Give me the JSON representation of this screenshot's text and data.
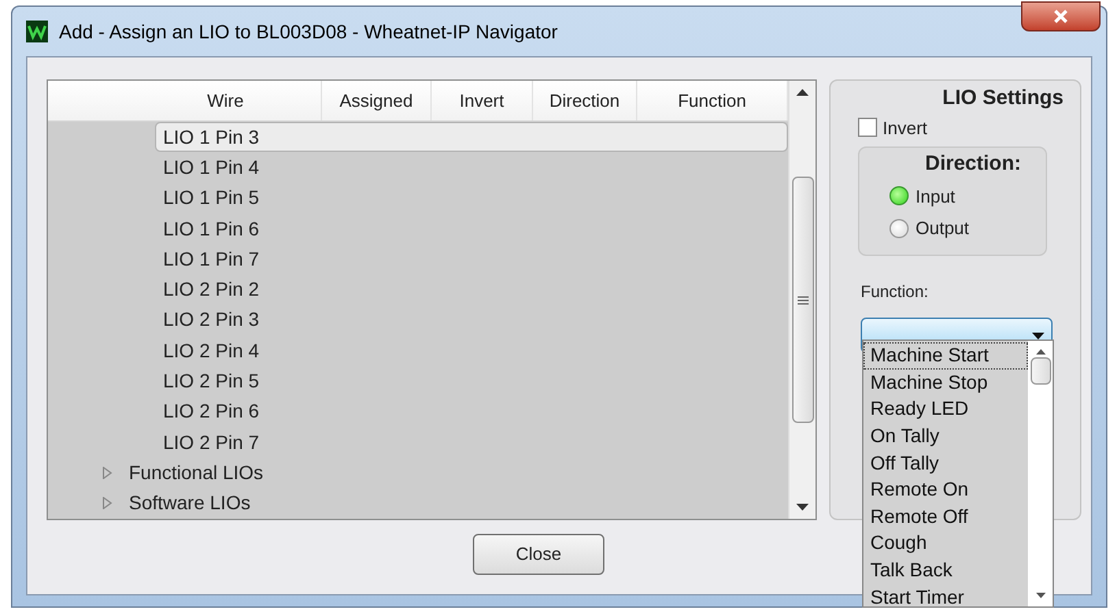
{
  "window": {
    "title": "Add - Assign an LIO to BL003D08 - Wheatnet-IP Navigator"
  },
  "table": {
    "columns": [
      "Wire",
      "Assigned",
      "Invert",
      "Direction",
      "Function"
    ],
    "rows": [
      {
        "kind": "leaf",
        "label": "LIO 1 Pin 3",
        "selected": true
      },
      {
        "kind": "leaf",
        "label": "LIO 1 Pin 4",
        "selected": false
      },
      {
        "kind": "leaf",
        "label": "LIO 1 Pin 5",
        "selected": false
      },
      {
        "kind": "leaf",
        "label": "LIO 1 Pin 6",
        "selected": false
      },
      {
        "kind": "leaf",
        "label": "LIO 1 Pin 7",
        "selected": false
      },
      {
        "kind": "leaf",
        "label": "LIO 2 Pin 2",
        "selected": false
      },
      {
        "kind": "leaf",
        "label": "LIO 2 Pin 3",
        "selected": false
      },
      {
        "kind": "leaf",
        "label": "LIO 2 Pin 4",
        "selected": false
      },
      {
        "kind": "leaf",
        "label": "LIO 2 Pin 5",
        "selected": false
      },
      {
        "kind": "leaf",
        "label": "LIO 2 Pin 6",
        "selected": false
      },
      {
        "kind": "leaf",
        "label": "LIO 2 Pin 7",
        "selected": false
      },
      {
        "kind": "group",
        "label": "Functional LIOs",
        "expanded": false,
        "selected": false
      },
      {
        "kind": "group",
        "label": "Software LIOs",
        "expanded": false,
        "selected": false
      }
    ]
  },
  "settings": {
    "title": "LIO Settings",
    "invert": {
      "label": "Invert",
      "checked": false
    },
    "direction": {
      "title": "Direction:",
      "options": [
        {
          "label": "Input",
          "selected": true
        },
        {
          "label": "Output",
          "selected": false
        }
      ]
    },
    "function": {
      "label": "Function:",
      "options": [
        {
          "label": "Machine Start",
          "selected": true
        },
        {
          "label": "Machine Stop",
          "selected": false
        },
        {
          "label": "Ready LED",
          "selected": false
        },
        {
          "label": "On Tally",
          "selected": false
        },
        {
          "label": "Off Tally",
          "selected": false
        },
        {
          "label": "Remote On",
          "selected": false
        },
        {
          "label": "Remote Off",
          "selected": false
        },
        {
          "label": "Cough",
          "selected": false
        },
        {
          "label": "Talk Back",
          "selected": false
        },
        {
          "label": "Start Timer",
          "selected": false
        }
      ]
    }
  },
  "buttons": [
    {
      "label": "Close"
    }
  ]
}
